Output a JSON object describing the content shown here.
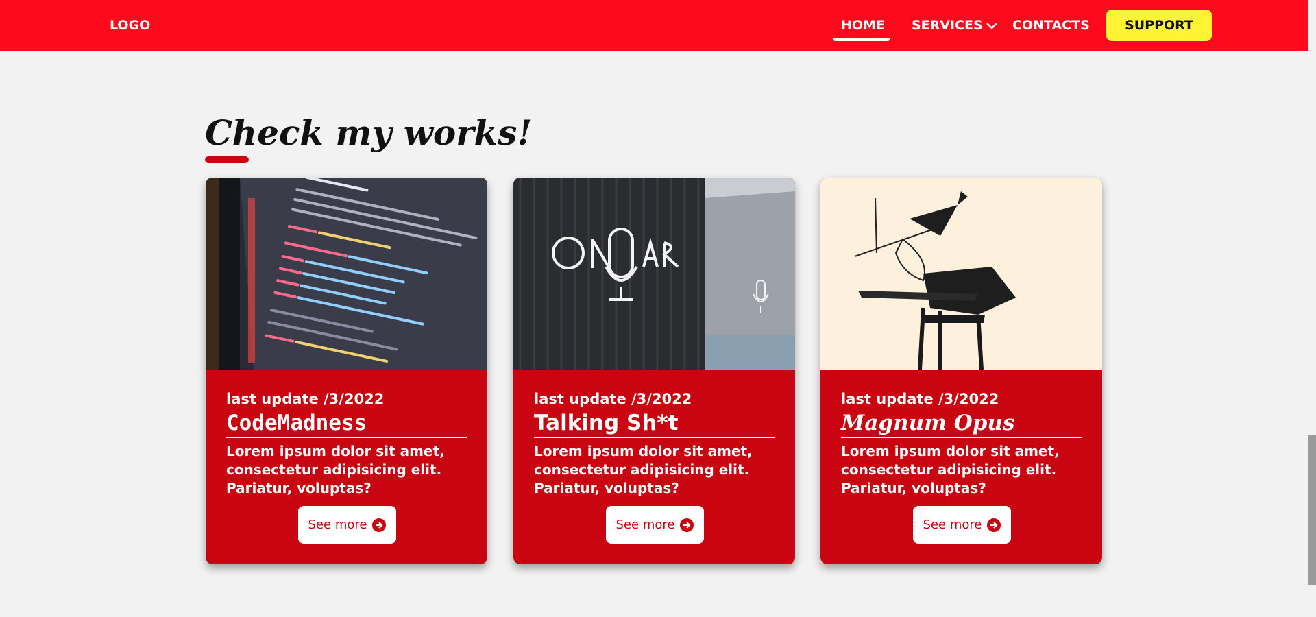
{
  "nav": {
    "logo": "LOGO",
    "items": [
      {
        "label": "HOME",
        "active": true
      },
      {
        "label": "SERVICES",
        "icon": "chevron-down-icon"
      },
      {
        "label": "CONTACTS"
      }
    ],
    "support_label": "SUPPORT"
  },
  "section": {
    "title": "Check my works!"
  },
  "cards": [
    {
      "image": "code-editor-screenshot",
      "date": "last update /3/2022",
      "title": "CodeMadness",
      "description": "Lorem ipsum dolor sit amet, consectetur adipisicing elit. Pariatur, voluptas?",
      "button_label": "See more",
      "button_icon": "arrow-circle-right-icon"
    },
    {
      "image": "on-air-neon-sign",
      "date": "last update /3/2022",
      "title": "Talking Sh*t",
      "description": "Lorem ipsum dolor sit amet, consectetur adipisicing elit. Pariatur, voluptas?",
      "button_label": "See more",
      "button_icon": "arrow-circle-right-icon"
    },
    {
      "image": "ink-drawing-cartoon",
      "date": "last update /3/2022",
      "title": "Magnum Opus",
      "description": "Lorem ipsum dolor sit amet, consectetur adipisicing elit. Pariatur, voluptas?",
      "button_label": "See more",
      "button_icon": "arrow-circle-right-icon"
    }
  ],
  "colors": {
    "navbar": "#ff0a1d",
    "card": "#c80510",
    "support": "#fff433",
    "background": "#f2f2f2"
  }
}
